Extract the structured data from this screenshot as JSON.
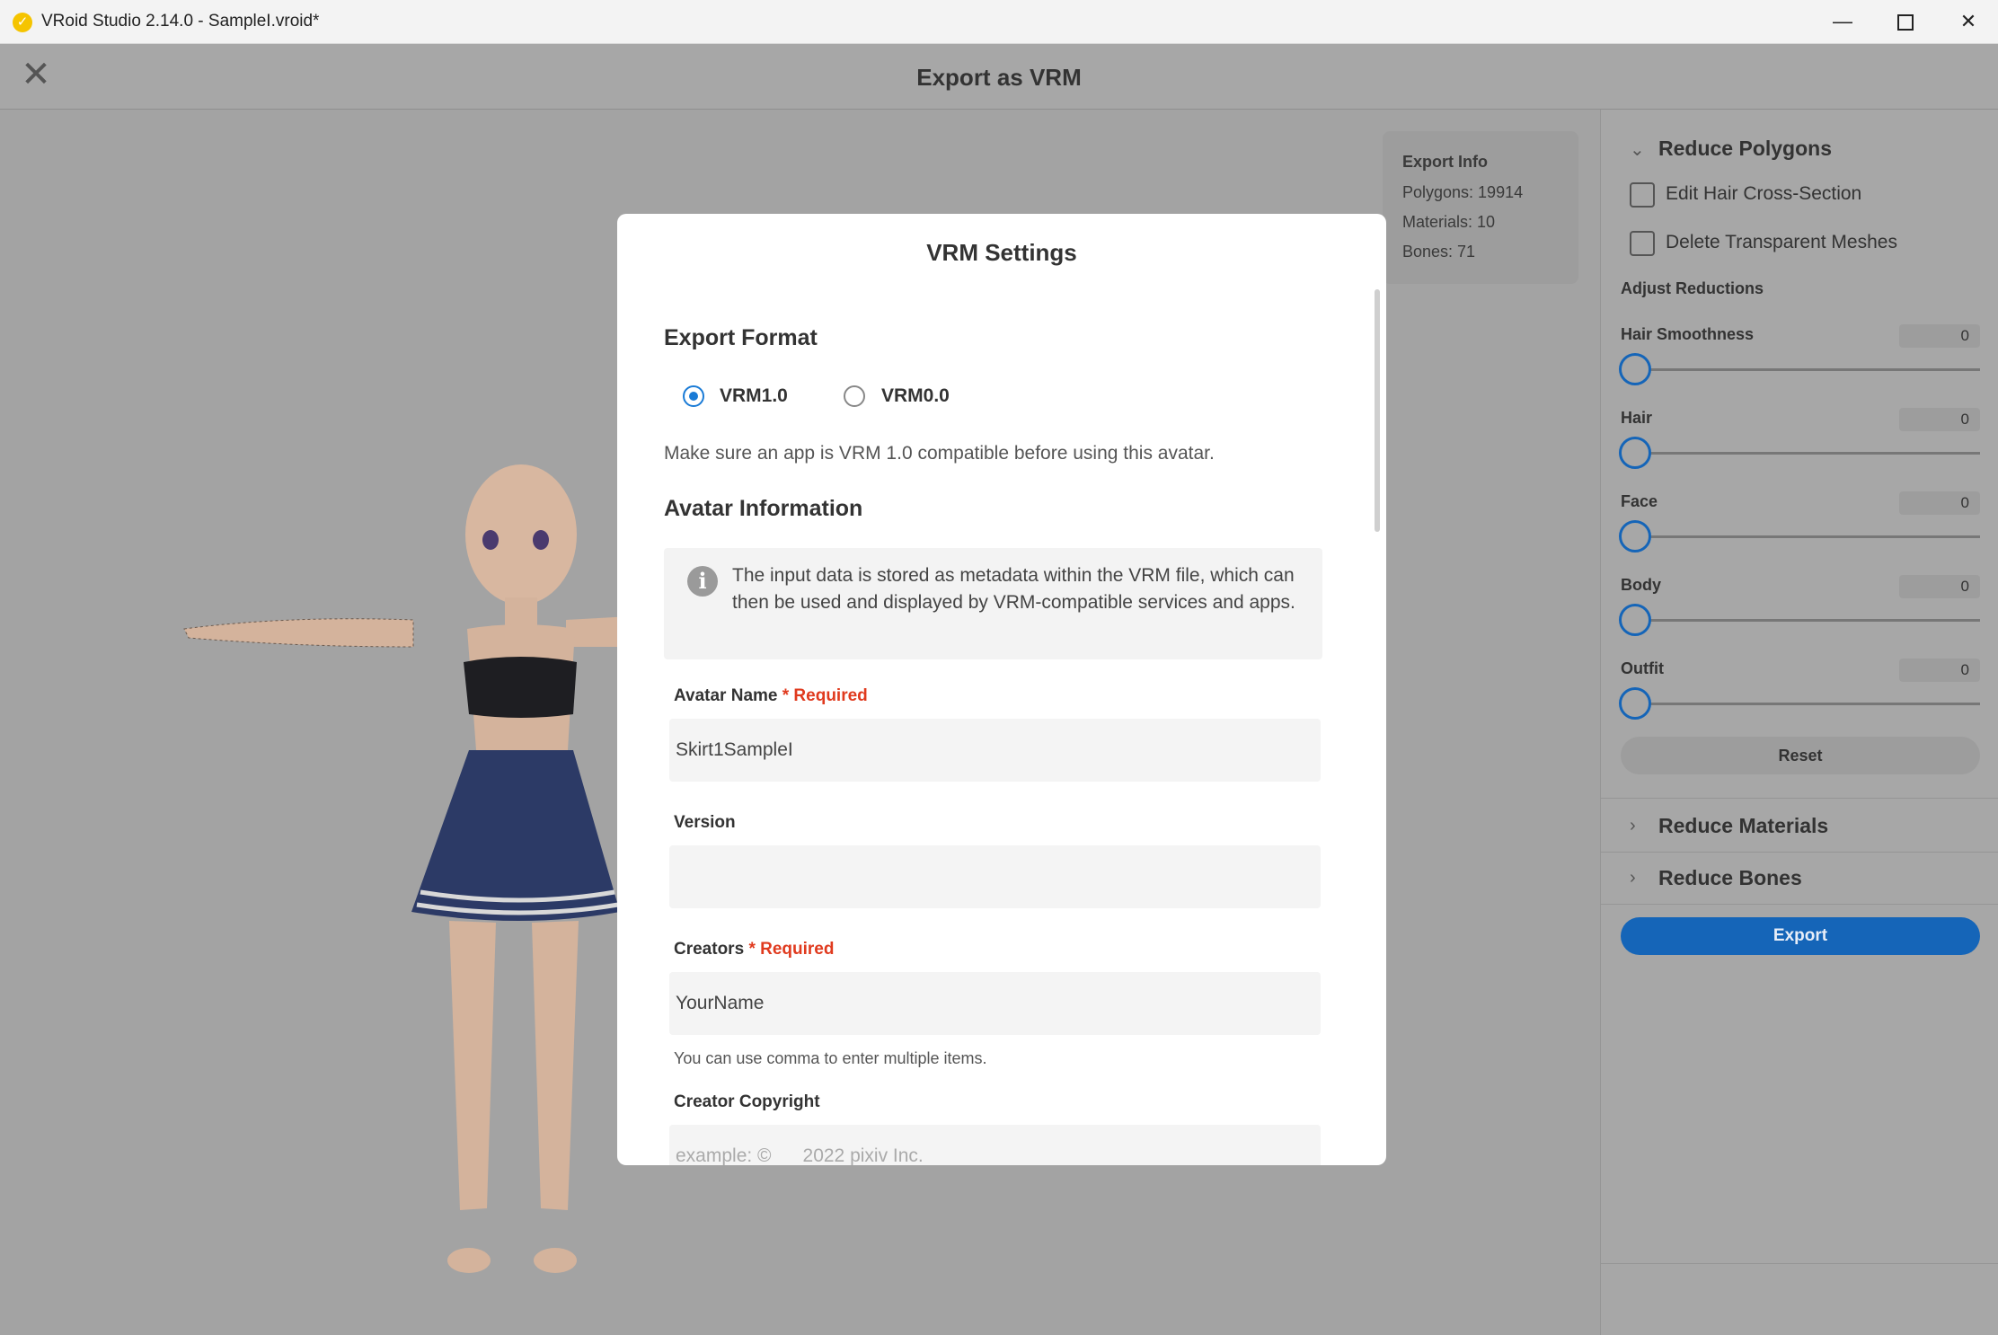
{
  "window": {
    "title": "VRoid Studio 2.14.0 - SampleI.vroid*",
    "minimize_glyph": "—",
    "close_glyph": "✕"
  },
  "header": {
    "title": "Export as VRM",
    "close_icon": "close-icon"
  },
  "export_info": {
    "title": "Export Info",
    "polygons": "Polygons: 19914",
    "materials": "Materials: 10",
    "bones": "Bones: 71"
  },
  "modal": {
    "title": "VRM Settings",
    "export_format": {
      "title": "Export Format",
      "options": [
        {
          "label": "VRM1.0",
          "selected": true
        },
        {
          "label": "VRM0.0",
          "selected": false
        }
      ],
      "note": "Make sure an app is VRM 1.0 compatible before using this avatar."
    },
    "avatar_information": {
      "title": "Avatar Information",
      "info_text": "The input data is stored as metadata within the VRM file, which can then be used and displayed by VRM-compatible services and apps.",
      "fields": {
        "avatar_name": {
          "label": "Avatar Name",
          "required": "* Required",
          "value": "Skirt1SampleI"
        },
        "version": {
          "label": "Version",
          "value": ""
        },
        "creators": {
          "label": "Creators",
          "required": "* Required",
          "value": "YourName",
          "hint": "You can use comma to enter multiple items."
        },
        "creator_copyright": {
          "label": "Creator Copyright",
          "placeholder": "example: ©      2022 pixiv Inc."
        }
      }
    }
  },
  "right_panel": {
    "reduce_polygons": {
      "title": "Reduce Polygons",
      "expanded": true,
      "checkboxes": [
        {
          "label": "Edit Hair Cross-Section",
          "checked": false
        },
        {
          "label": "Delete Transparent Meshes",
          "checked": false
        }
      ],
      "adjust_title": "Adjust Reductions",
      "sliders": [
        {
          "label": "Hair Smoothness",
          "value": "0"
        },
        {
          "label": "Hair",
          "value": "0"
        },
        {
          "label": "Face",
          "value": "0"
        },
        {
          "label": "Body",
          "value": "0"
        },
        {
          "label": "Outfit",
          "value": "0"
        }
      ],
      "reset_label": "Reset"
    },
    "reduce_materials": {
      "title": "Reduce Materials",
      "expanded": false
    },
    "reduce_bones": {
      "title": "Reduce Bones",
      "expanded": false
    },
    "export_label": "Export"
  },
  "colors": {
    "accent": "#1565b8",
    "radio_selected": "#1a7bd6",
    "required": "#e03a1e",
    "app_icon": "#f5c400"
  }
}
